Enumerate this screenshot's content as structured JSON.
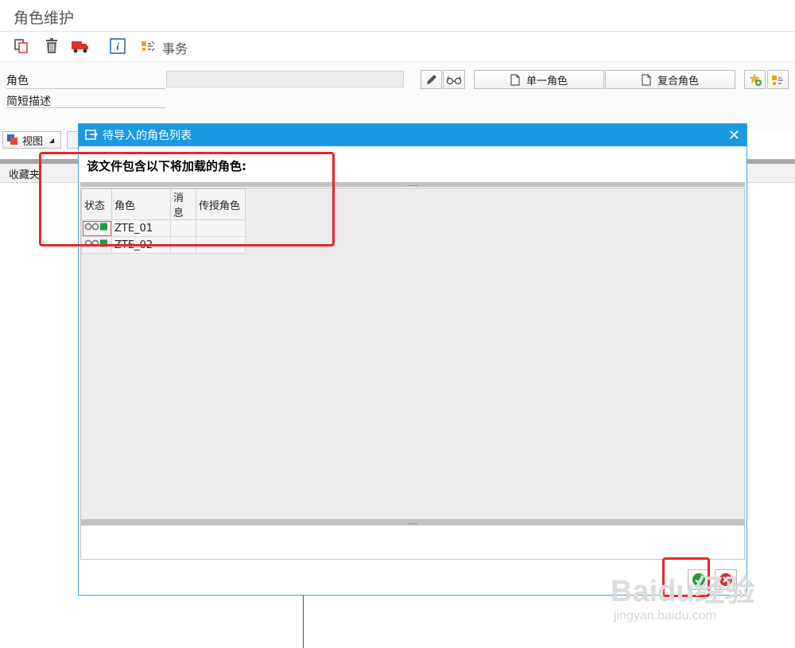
{
  "app": {
    "title": "角色维护"
  },
  "toolbar": {
    "transaction_label": "事务"
  },
  "form": {
    "role_label": "角色",
    "description_label": "简短描述",
    "single_role_label": "单一角色",
    "composite_role_label": "复合角色"
  },
  "tree": {
    "view_label": "视图",
    "favorites_label": "收藏夹"
  },
  "dialog": {
    "title": "待导入的角色列表",
    "message": "该文件包含以下将加载的角色:",
    "columns": [
      "状态",
      "角色",
      "消息",
      "传授角色"
    ],
    "rows": [
      {
        "role": "ZTE_01",
        "message": "",
        "transfer": ""
      },
      {
        "role": "ZTE_02",
        "message": "",
        "transfer": ""
      }
    ]
  },
  "watermark": {
    "brand": "Baidu经验",
    "url": "jingyan.baidu.com"
  },
  "colors": {
    "dialog_header": "#1a9ae2",
    "highlight": "#e8262b",
    "status_green": "#1a9e3c"
  }
}
